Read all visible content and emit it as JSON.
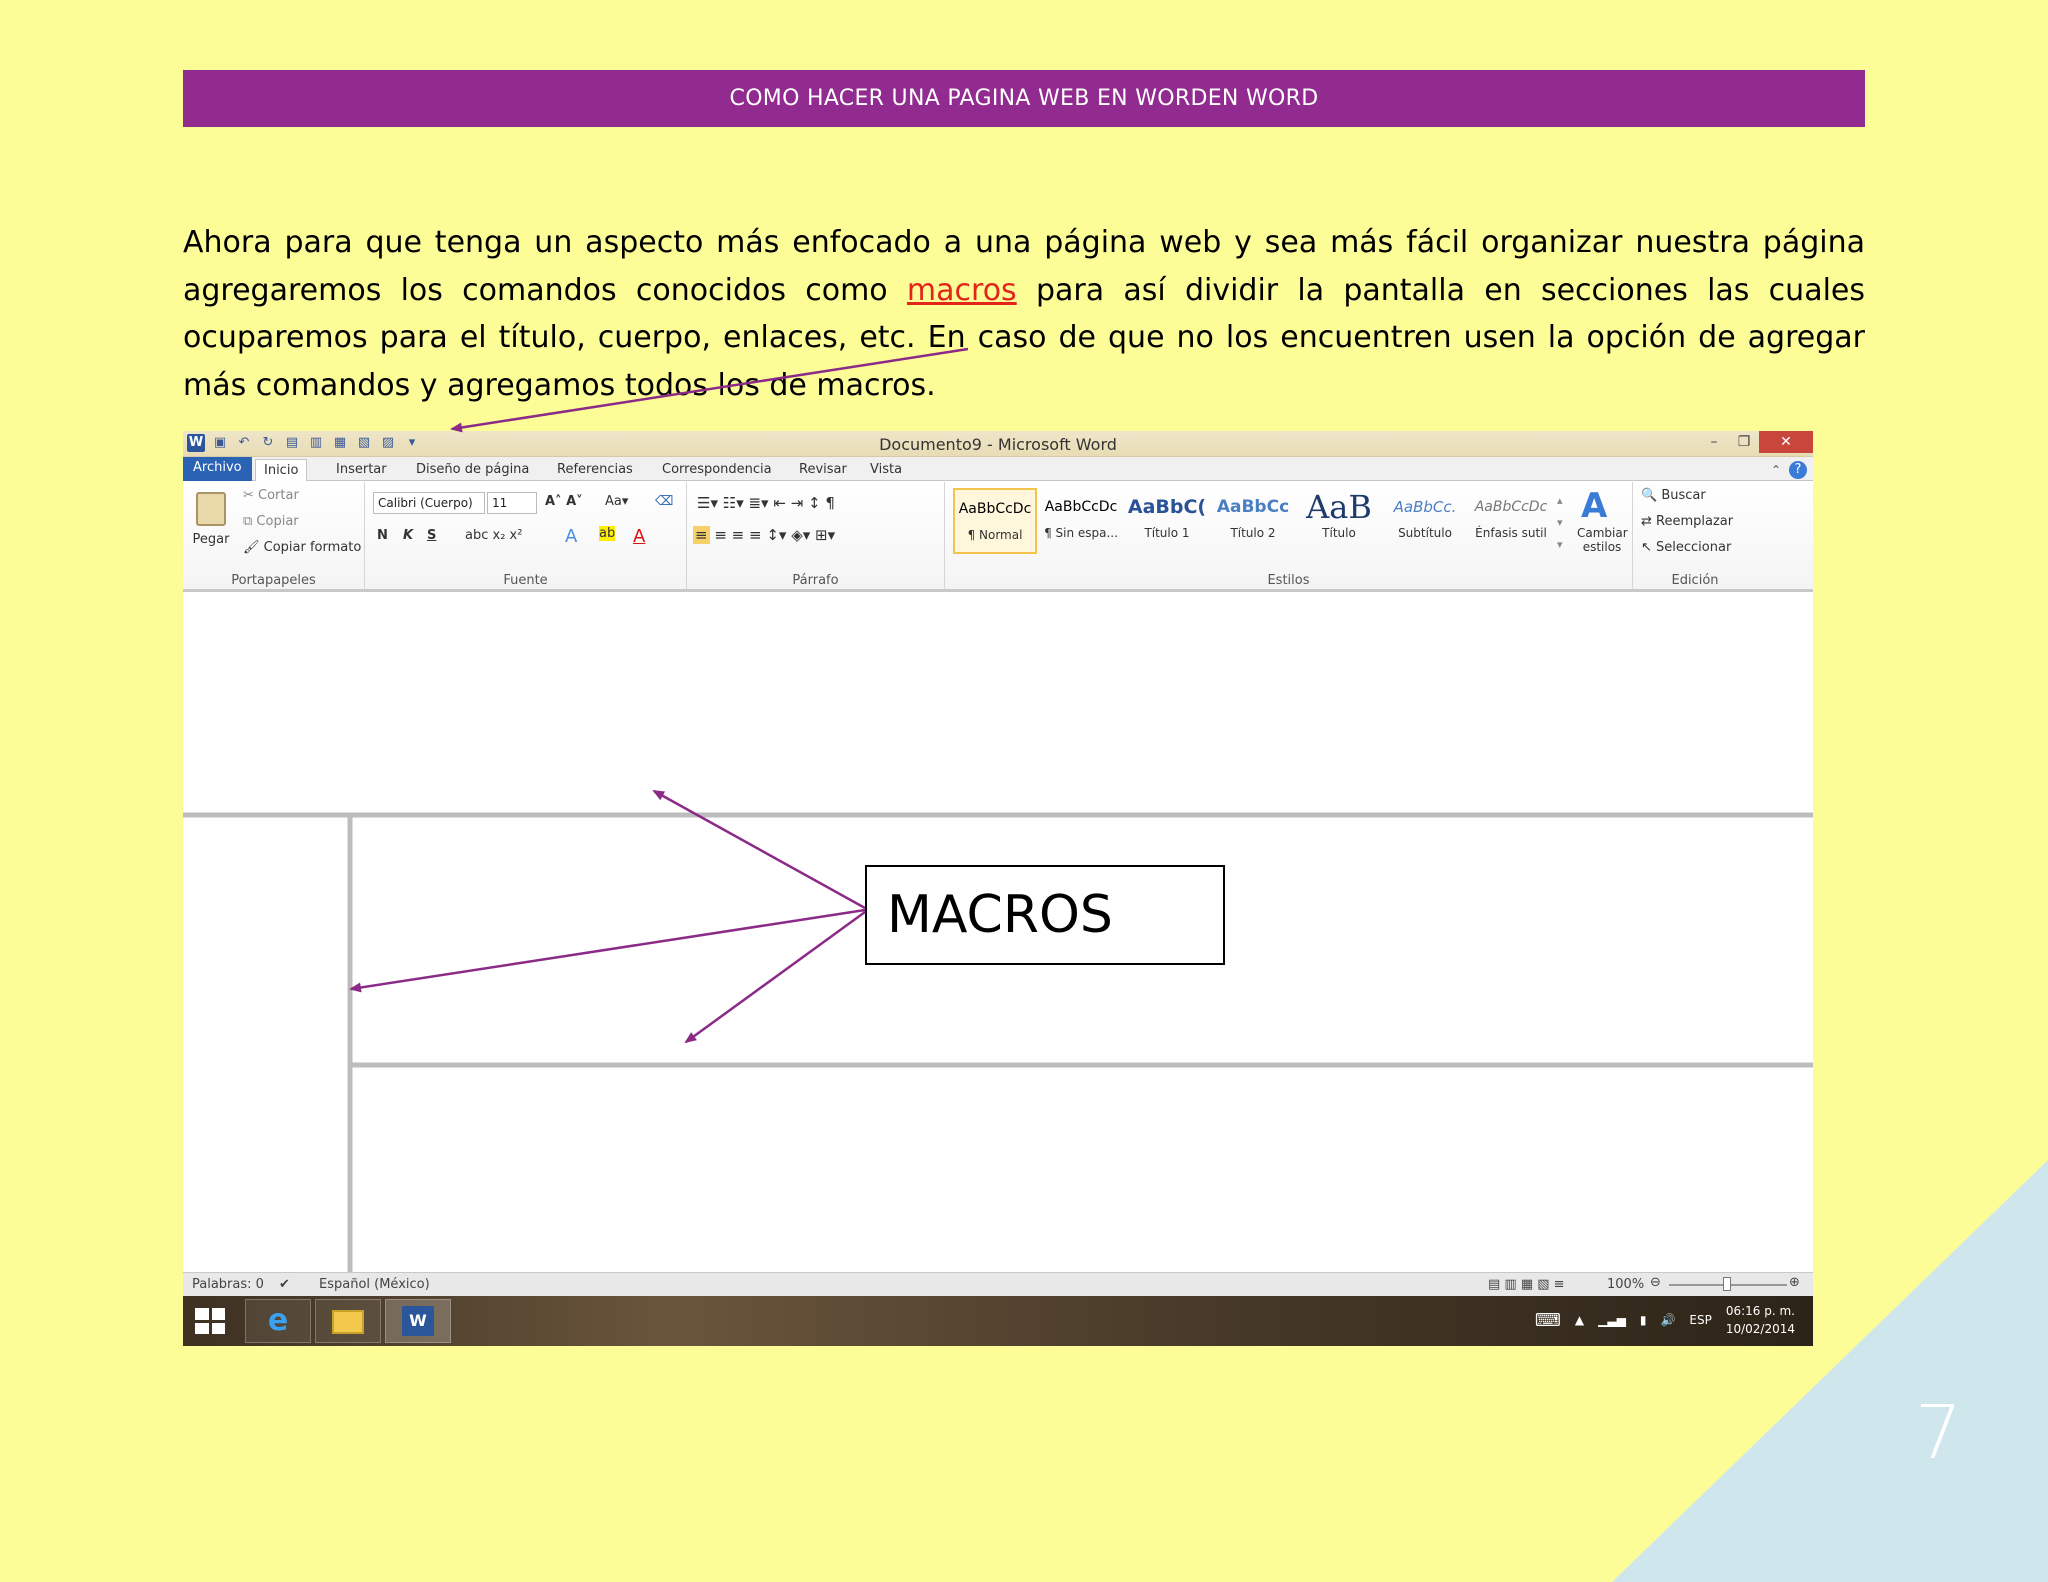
{
  "banner": "COMO HACER UNA PAGINA WEB EN WORDEN WORD",
  "paragraph": {
    "part1": "Ahora para que tenga un aspecto más enfocado a una página web y sea más fácil organizar nuestra página agregaremos los comandos conocidos como ",
    "link": "macros",
    "part2": " para así dividir la pantalla en secciones las cuales ocuparemos para el título, cuerpo, enlaces, etc. En caso de que no los encuentren usen la opción de agregar más comandos y agregamos todos los de macros."
  },
  "callout": "MACROS",
  "page_number": "7",
  "colors": {
    "background": "#fdfd98",
    "banner": "#922b8f",
    "corner": "#cfe7ec",
    "arrow": "#8b2a87",
    "link": "#e3241b"
  },
  "word": {
    "title": "Documento9 - Microsoft Word",
    "tabs": [
      "Archivo",
      "Inicio",
      "Insertar",
      "Diseño de página",
      "Referencias",
      "Correspondencia",
      "Revisar",
      "Vista"
    ],
    "clipboard": {
      "paste": "Pegar",
      "cut": "Cortar",
      "copy": "Copiar",
      "format_painter": "Copiar formato",
      "label": "Portapapeles"
    },
    "font": {
      "name": "Calibri (Cuerpo)",
      "size": "11",
      "label": "Fuente",
      "bold": "N",
      "italic": "K",
      "underline": "S"
    },
    "paragraph_label": "Párrafo",
    "styles": [
      {
        "preview": "AaBbCcDc",
        "name": "¶ Normal"
      },
      {
        "preview": "AaBbCcDc",
        "name": "¶ Sin espa..."
      },
      {
        "preview": "AaBbC(",
        "name": "Título 1"
      },
      {
        "preview": "AaBbCc",
        "name": "Título 2"
      },
      {
        "preview": "AaB",
        "name": "Título"
      },
      {
        "preview": "AaBbCc.",
        "name": "Subtítulo"
      },
      {
        "preview": "AaBbCcDc",
        "name": "Énfasis sutil"
      }
    ],
    "styles_label": "Estilos",
    "change_styles": "Cambiar estilos",
    "editing": {
      "find": "Buscar",
      "replace": "Reemplazar",
      "select": "Seleccionar",
      "label": "Edición"
    },
    "status": {
      "words": "Palabras: 0",
      "language": "Español (México)",
      "zoom": "100%"
    },
    "taskbar": {
      "lang": "ESP",
      "time": "06:16 p. m.",
      "date": "10/02/2014"
    }
  }
}
